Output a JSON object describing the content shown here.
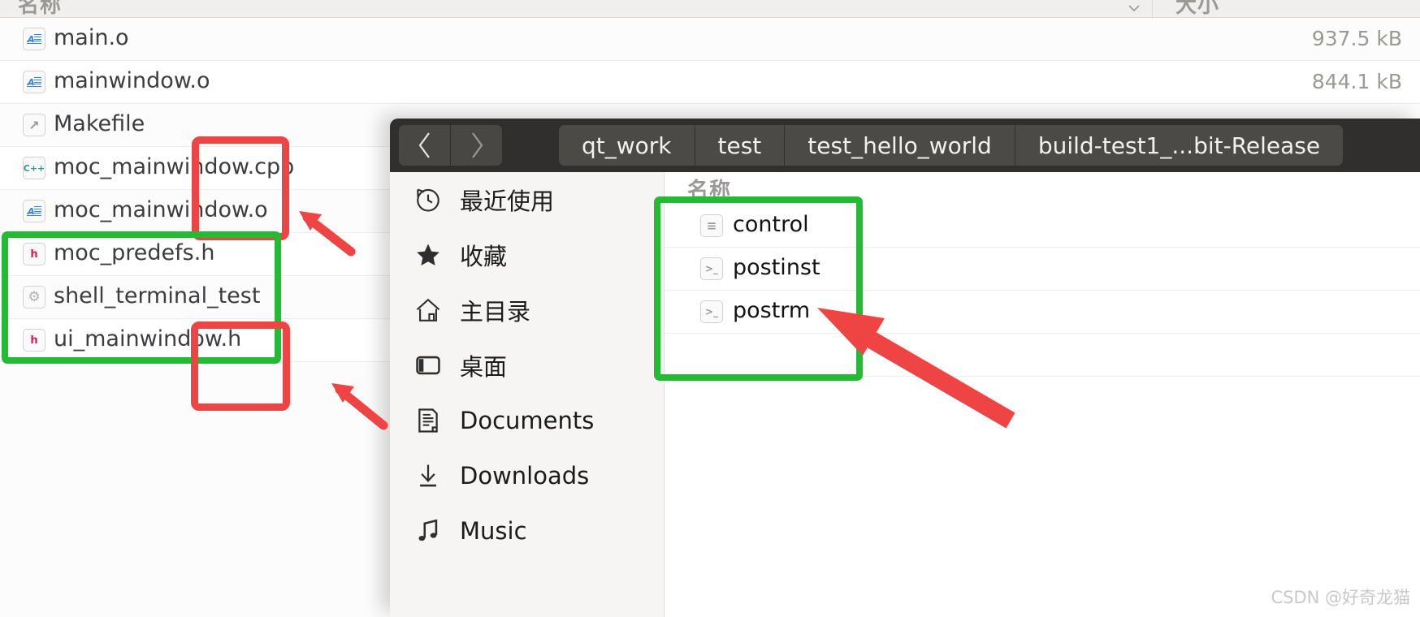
{
  "back_window": {
    "columns": {
      "name": "名称",
      "size": "大小"
    },
    "sort_icon": "chevron-down-icon",
    "rows": [
      {
        "name": "main.o",
        "size": "937.5 kB",
        "icon": "text-file-icon",
        "icon_glyph": "A",
        "icon_color": "#3584e4"
      },
      {
        "name": "mainwindow.o",
        "size": "844.1 kB",
        "icon": "text-file-icon",
        "icon_glyph": "A",
        "icon_color": "#3584e4"
      },
      {
        "name": "Makefile",
        "size": "",
        "icon": "makefile-icon",
        "icon_glyph": "↗",
        "icon_color": "#9a9996"
      },
      {
        "name": "moc_mainwindow.cpp",
        "size": "",
        "icon": "cpp-file-icon",
        "icon_glyph": "C++",
        "icon_color": "#2a9d8f"
      },
      {
        "name": "moc_mainwindow.o",
        "size": "",
        "icon": "text-file-icon",
        "icon_glyph": "A",
        "icon_color": "#3584e4"
      },
      {
        "name": "moc_predefs.h",
        "size": "",
        "icon": "header-file-icon",
        "icon_glyph": "h",
        "icon_color": "#e01b4c"
      },
      {
        "name": "shell_terminal_test",
        "size": "",
        "icon": "executable-icon",
        "icon_glyph": "⚙",
        "icon_color": "#b5b3b0"
      },
      {
        "name": "ui_mainwindow.h",
        "size": "",
        "icon": "header-file-icon",
        "icon_glyph": "h",
        "icon_color": "#e01b4c"
      },
      {
        "name": "",
        "size": "",
        "icon": "",
        "icon_glyph": "",
        "icon_color": ""
      }
    ]
  },
  "front_window": {
    "nav": {
      "back_label": "‹",
      "forward_label": "›"
    },
    "breadcrumbs": [
      {
        "label": "qt_work"
      },
      {
        "label": "test"
      },
      {
        "label": "test_hello_world"
      },
      {
        "label": "build-test1_...bit-Release"
      }
    ],
    "sidebar": [
      {
        "label": "最近使用",
        "icon": "recent-clock-icon"
      },
      {
        "label": "收藏",
        "icon": "star-icon"
      },
      {
        "label": "主目录",
        "icon": "home-icon"
      },
      {
        "label": "桌面",
        "icon": "desktop-icon"
      },
      {
        "label": "Documents",
        "icon": "documents-icon"
      },
      {
        "label": "Downloads",
        "icon": "download-arrow-icon"
      },
      {
        "label": "Music",
        "icon": "music-note-icon"
      }
    ],
    "file_pane": {
      "column_name": "名称",
      "files": [
        {
          "name": "control",
          "icon": "text-file-icon",
          "icon_glyph": "≡"
        },
        {
          "name": "postinst",
          "icon": "script-file-icon",
          "icon_glyph": ">_"
        },
        {
          "name": "postrm",
          "icon": "script-file-icon",
          "icon_glyph": ">_"
        },
        {
          "name": "",
          "icon": "",
          "icon_glyph": ""
        }
      ]
    }
  },
  "annotations": {
    "green_color": "#22bb33",
    "red_color": "#ef4444",
    "boxes": [
      {
        "name": "red-box-moc-mainwindow"
      },
      {
        "name": "green-box-left-files"
      },
      {
        "name": "red-box-ui-mainwindow"
      },
      {
        "name": "green-box-right-files"
      }
    ],
    "arrows": [
      {
        "name": "red-arrow-upper-left"
      },
      {
        "name": "red-arrow-lower-left"
      },
      {
        "name": "red-arrow-right-files"
      }
    ]
  },
  "watermark": {
    "text": "CSDN @好奇龙猫"
  }
}
